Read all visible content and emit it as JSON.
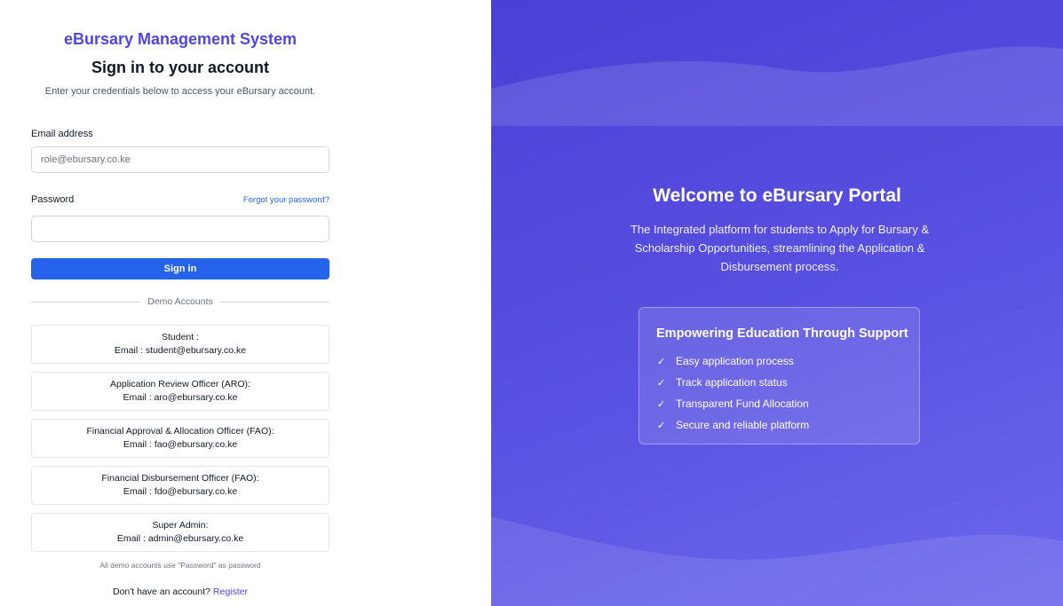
{
  "login": {
    "brand": "eBursary Management System",
    "heading": "Sign in to your account",
    "subheading": "Enter your credentials below to access your eBursary account.",
    "email_label": "Email address",
    "email_placeholder": "role@ebursary.co.ke",
    "email_value": "",
    "password_label": "Password",
    "password_value": "",
    "forgot_link": "Forgot your password?",
    "signin_button": "Sign in",
    "divider_text": "Demo Accounts",
    "demo_accounts": [
      {
        "role": "Student :",
        "email": "Email : student@ebursary.co.ke"
      },
      {
        "role": "Application Review Officer (ARO):",
        "email": "Email : aro@ebursary.co.ke"
      },
      {
        "role": "Financial Approval & Allocation Officer (FAO):",
        "email": "Email : fao@ebursary.co.ke"
      },
      {
        "role": "Financial Disbursement Officer (FAO):",
        "email": "Email : fdo@ebursary.co.ke"
      },
      {
        "role": "Super Admin:",
        "email": "Email : admin@ebursary.co.ke"
      }
    ],
    "demo_note": "All demo accounts use \"Password\" as password",
    "register_prompt": "Don't have an account?",
    "register_link": "Register"
  },
  "hero": {
    "title": "Welcome to eBursary Portal",
    "description": "The Integrated platform for students to Apply for Bursary & Scholarship Opportunities, streamlining the Application & Disbursement process.",
    "card_title": "Empowering Education Through Support",
    "features": [
      "Easy application process",
      "Track application status",
      "Transparent Fund Allocation",
      "Secure and reliable platform"
    ],
    "check_icon": "check-icon"
  },
  "colors": {
    "brand": "#4f46e5",
    "primary_button": "#2563eb",
    "hero_background": "#5048e5"
  }
}
